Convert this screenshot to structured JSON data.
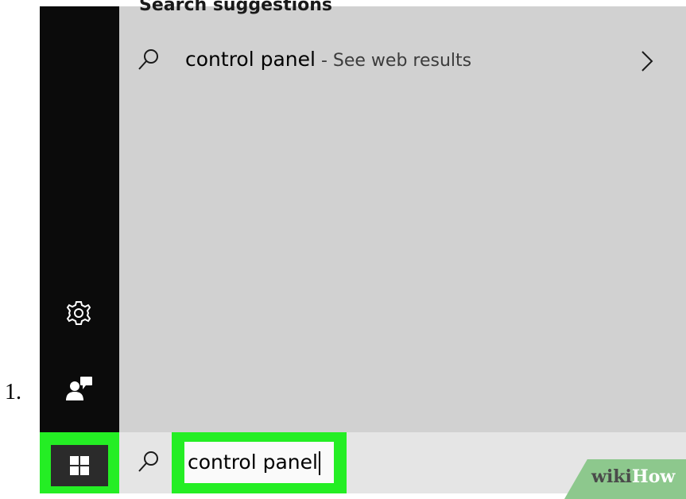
{
  "step": {
    "number": "1."
  },
  "search_panel": {
    "section_title": "Search suggestions",
    "suggestion": {
      "query": "control panel",
      "suffix": " - See web results",
      "icon": "search-icon",
      "chevron": "chevron-right-icon"
    }
  },
  "sidebar": {
    "settings_icon": "gear-icon",
    "user_icon": "user-feedback-icon",
    "start_icon": "windows-logo-icon"
  },
  "searchbar": {
    "value": "control panel",
    "icon": "search-icon"
  },
  "watermark": {
    "part1": "wiki",
    "part2": "How"
  },
  "colors": {
    "highlight": "#24ee24",
    "sidebar": "#0b0b0b",
    "panel": "#d1d1d1",
    "searchbar": "#e5e5e5"
  }
}
